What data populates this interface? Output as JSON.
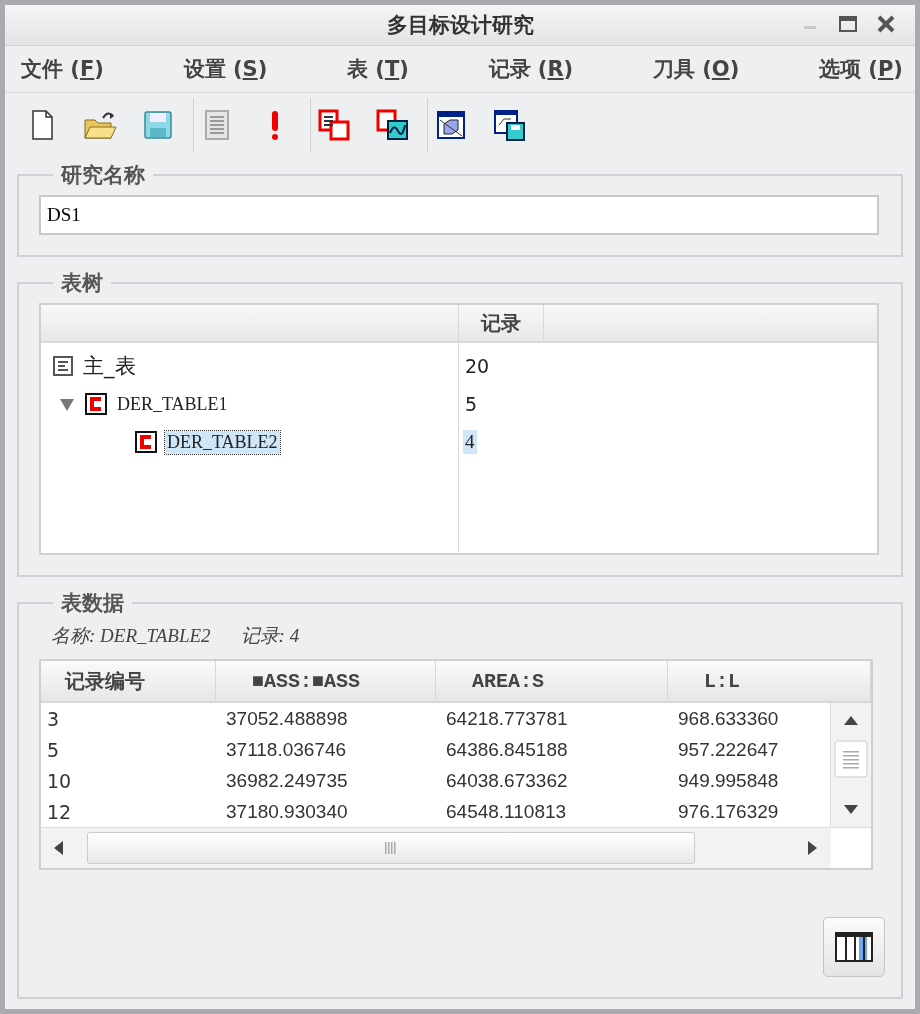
{
  "window": {
    "title": "多目标设计研究"
  },
  "menu": [
    {
      "label": "文件 (",
      "mnemonic": "F",
      "suffix": ")"
    },
    {
      "label": "设置 (",
      "mnemonic": "S",
      "suffix": ")"
    },
    {
      "label": "表 (",
      "mnemonic": "T",
      "suffix": ")"
    },
    {
      "label": "记录 (",
      "mnemonic": "R",
      "suffix": ")"
    },
    {
      "label": "刀具 (",
      "mnemonic": "O",
      "suffix": ")"
    },
    {
      "label": "选项 (",
      "mnemonic": "P",
      "suffix": ")"
    }
  ],
  "toolbar": [
    [
      {
        "kind": "new",
        "disabled": false
      },
      {
        "kind": "open",
        "disabled": false
      },
      {
        "kind": "save",
        "disabled": false
      }
    ],
    [
      {
        "kind": "list",
        "disabled": true
      },
      {
        "kind": "alert",
        "disabled": false
      }
    ],
    [
      {
        "kind": "copy",
        "disabled": false
      },
      {
        "kind": "graph",
        "disabled": false
      }
    ],
    [
      {
        "kind": "model",
        "disabled": false
      },
      {
        "kind": "model-save",
        "disabled": false
      }
    ]
  ],
  "study_name": {
    "legend": "研究名称",
    "value": "DS1"
  },
  "table_tree": {
    "legend": "表树",
    "column": "记录",
    "rows": [
      {
        "kind": "master",
        "name": "主_表",
        "records": "20",
        "selected": false
      },
      {
        "kind": "derived",
        "name": "DER_TABLE1",
        "records": "5",
        "selected": false,
        "expanded": true,
        "children": [
          {
            "kind": "derived",
            "name": "DER_TABLE2",
            "records": "4",
            "selected": true
          }
        ]
      }
    ]
  },
  "table_data": {
    "legend": "表数据",
    "name_label": "名称:",
    "name": "DER_TABLE2",
    "records_label": "记录:",
    "records": "4",
    "columns": [
      "记录编号",
      "■ASS:■ASS",
      "AREA:S",
      "L:L"
    ],
    "rows": [
      [
        "3",
        "37052.488898",
        "64218.773781",
        "968.633360"
      ],
      [
        "5",
        "37118.036746",
        "64386.845188",
        "957.222647"
      ],
      [
        "10",
        "36982.249735",
        "64038.673362",
        "949.995848"
      ],
      [
        "12",
        "37180.930340",
        "64548.110813",
        "976.176329"
      ]
    ]
  }
}
